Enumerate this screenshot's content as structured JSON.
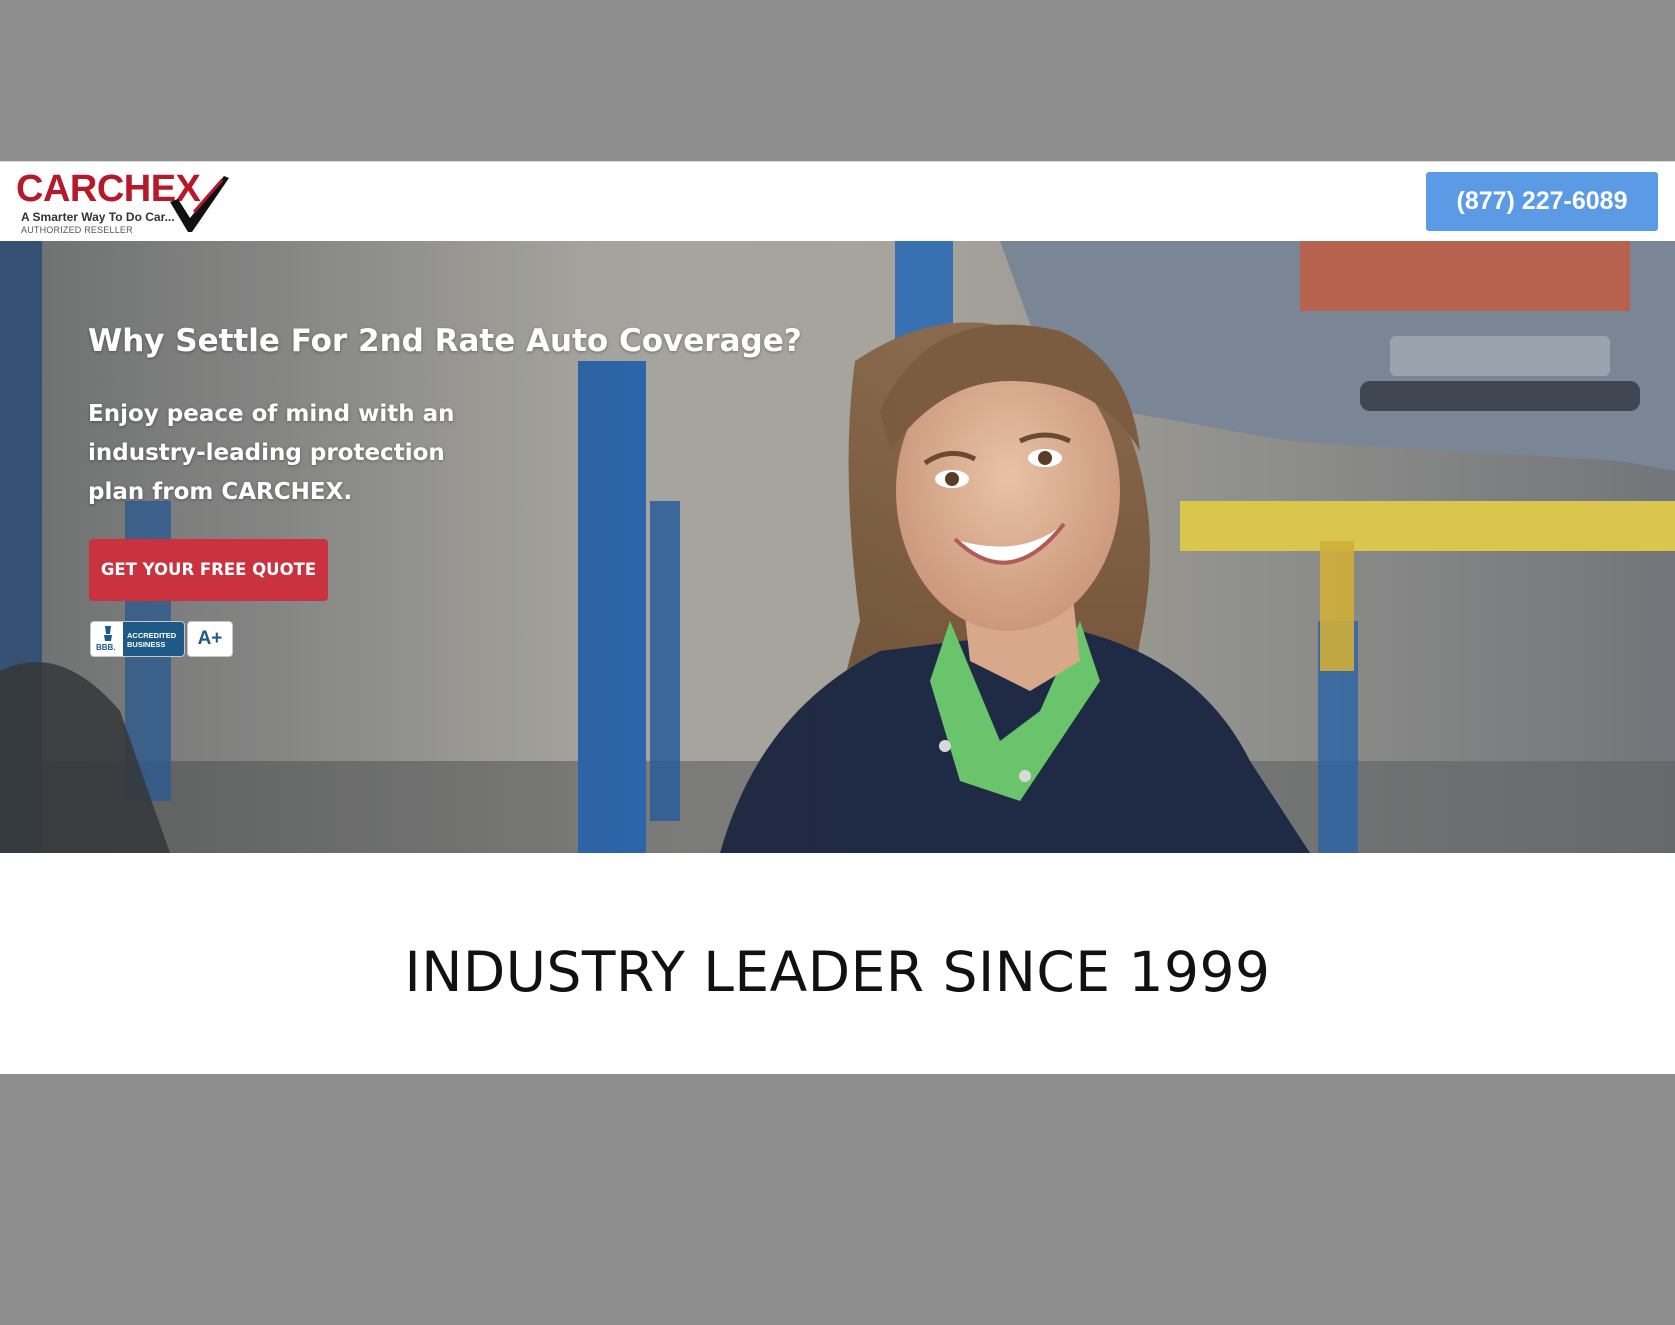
{
  "header": {
    "logo": {
      "wordmark": "CARCHEX",
      "tagline": "A Smarter Way To Do Car...",
      "subline": "AUTHORIZED RESELLER",
      "icon": "checkmark-icon"
    },
    "phone_label": "(877) 227-6089"
  },
  "hero": {
    "title": "Why Settle For 2nd Rate Auto Coverage?",
    "subtitle": "Enjoy peace of mind with an industry-leading protection plan from CARCHEX.",
    "cta_label": "GET YOUR FREE QUOTE",
    "bbb_badge": {
      "seal": "BBB.",
      "line1": "ACCREDITED",
      "line2": "BUSINESS",
      "icon": "bbb-torch-icon"
    },
    "rating": "A+"
  },
  "leader": {
    "heading": "INDUSTRY LEADER SINCE 1999"
  },
  "colors": {
    "brand_red": "#b5192a",
    "cta_red": "#c9323e",
    "phone_blue": "#5b9be6",
    "bbb_blue": "#1f5a87",
    "backdrop_gray": "#8e8e8e"
  }
}
